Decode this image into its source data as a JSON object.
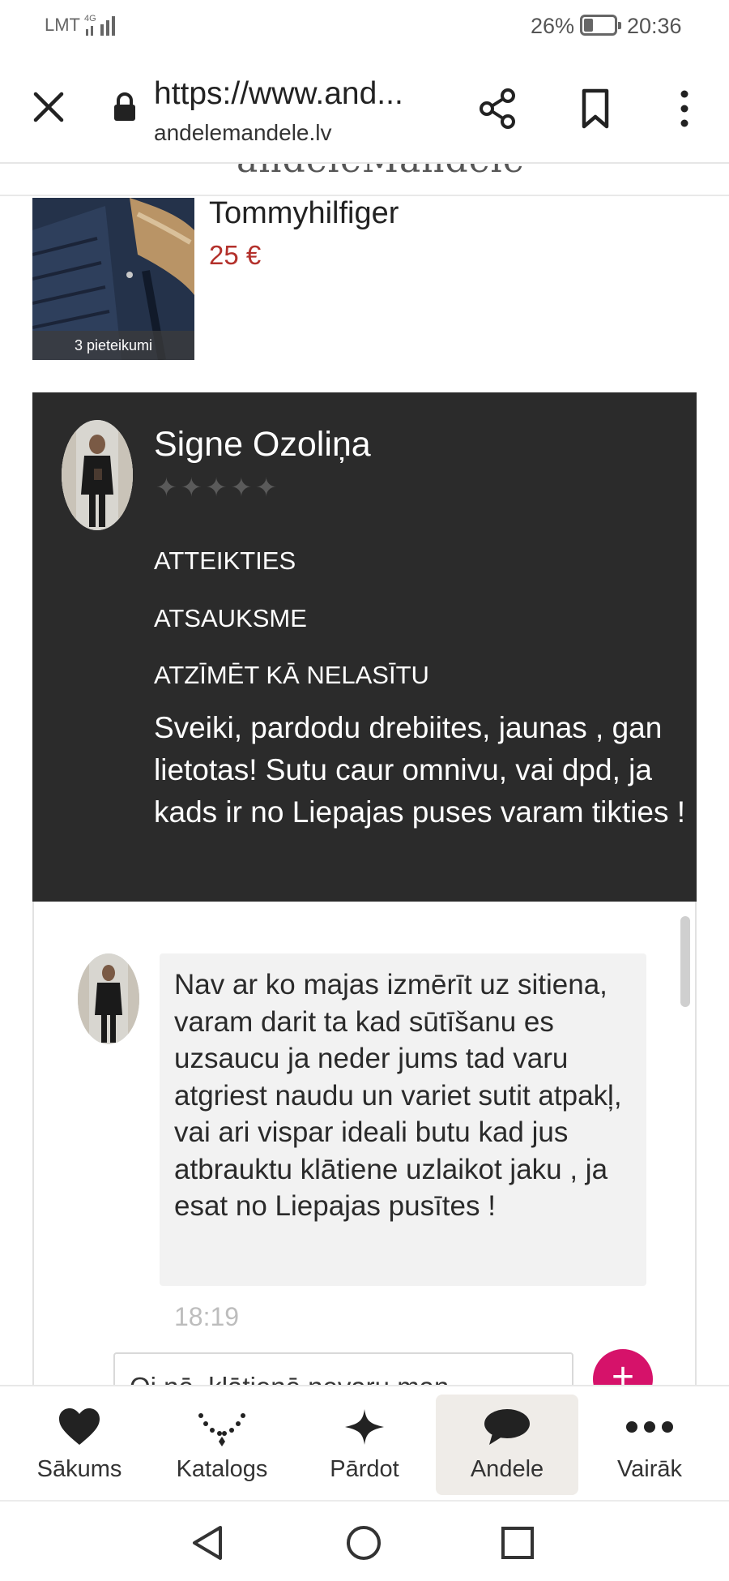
{
  "status_bar": {
    "carrier": "LMT",
    "network": "4G",
    "battery_percent": "26%",
    "time": "20:36"
  },
  "browser": {
    "url": "https://www.and...",
    "domain": "andelemandele.lv",
    "icons": [
      "close-icon",
      "lock-icon",
      "share-icon",
      "bookmark-icon",
      "more-vertical-icon"
    ]
  },
  "site": {
    "logo": "andeleMandele"
  },
  "listing": {
    "title": "Tommyhilfiger",
    "price": "25 €",
    "applications": "3 pieteikumi"
  },
  "seller": {
    "name": "Signe Ozoliņa",
    "rating_stars": "✦✦✦✦✦",
    "actions": [
      "ATTEIKTIES",
      "ATSAUKSME",
      "ATZĪMĒT KĀ NELASĪTU"
    ],
    "description": "Sveiki, pardodu drebiites, jaunas , gan lietotas! Sutu caur omnivu, vai dpd, ja kads ir no Liepajas puses varam tikties !"
  },
  "chat": {
    "message": "Nav ar ko majas izmērīt uz sitiena, varam darit ta kad sūtīšanu es uzsaucu ja neder jums tad varu atgriest naudu un variet sutit atpakļ, vai ari vispar ideali butu kad jus atbrauktu klātiene uzlaikot jaku , ja esat no Liepajas pusītes !",
    "time": "18:19",
    "reply_preview": "Oi nē, klātienē nevaru man",
    "add_button": "+"
  },
  "bottom_nav": [
    {
      "label": "Sākums",
      "icon": "heart-icon"
    },
    {
      "label": "Katalogs",
      "icon": "necklace-icon"
    },
    {
      "label": "Pārdot",
      "icon": "sparkle-icon"
    },
    {
      "label": "Andele",
      "icon": "chat-bubble-icon",
      "active": true
    },
    {
      "label": "Vairāk",
      "icon": "more-horizontal-icon"
    }
  ],
  "colors": {
    "price": "#b3302b",
    "seller_panel": "#2b2b2b",
    "add_button": "#d6126a",
    "active_tab": "#efece8"
  }
}
